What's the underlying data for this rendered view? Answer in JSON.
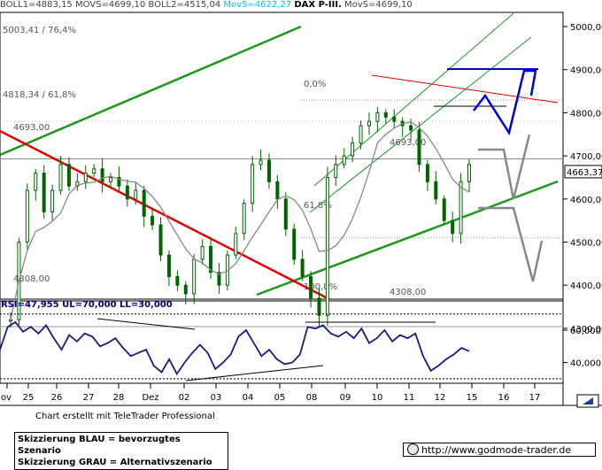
{
  "header": {
    "boll1": "BOLL1=4883,15",
    "movs1": "MOVS=4699,10",
    "boll2": "BOLL2=4515,04",
    "movs2": "MovS=4622,27",
    "title": "DAX P-III.",
    "movs3": "MovS=4699,10",
    "colors": {
      "boll": "#444444",
      "movs_cyan": "#00bfff",
      "title": "#000000"
    }
  },
  "chart_data": [
    {
      "type": "candlestick",
      "name_note": "DAX P-III.",
      "ylim": [
        4280,
        5020
      ],
      "y_ticks": [
        {
          "v": 5000,
          "label": "5000,00"
        },
        {
          "v": 4900,
          "label": "4900,00"
        },
        {
          "v": 4800,
          "label": "4800,00"
        },
        {
          "v": 4700,
          "label": "4700,00"
        },
        {
          "v": 4600,
          "label": "4600,00"
        },
        {
          "v": 4500,
          "label": "4500,00"
        },
        {
          "v": 4400,
          "label": "4400,00"
        },
        {
          "v": 4300,
          "label": "4300,00"
        }
      ],
      "x_ticks": [
        "ov",
        "25",
        "26",
        "27",
        "28",
        "Dez",
        "02",
        "03",
        "04",
        "05",
        "08",
        "09",
        "10",
        "11",
        "12",
        "15",
        "16",
        "17"
      ],
      "last_price": {
        "value": 4663.37,
        "label": "4663,37"
      },
      "close_series": [
        4320,
        4500,
        4620,
        4660,
        4570,
        4620,
        4680,
        4630,
        4640,
        4660,
        4670,
        4640,
        4650,
        4630,
        4600,
        4620,
        4560,
        4540,
        4470,
        4420,
        4400,
        4380,
        4460,
        4490,
        4430,
        4400,
        4470,
        4520,
        4590,
        4680,
        4690,
        4640,
        4600,
        4530,
        4460,
        4420,
        4370,
        4330,
        4650,
        4680,
        4700,
        4730,
        4770,
        4780,
        4800,
        4790,
        4780,
        4770,
        4760,
        4680,
        4640,
        4600,
        4550,
        4520,
        4640,
        4680
      ],
      "fib_levels": [
        {
          "label": "5003,41 / 76,4%",
          "value": 5003.41
        },
        {
          "label": "4818,34 / 61,8%",
          "value": 4818.34
        },
        {
          "label": "4693,00",
          "value": 4693
        },
        {
          "label": "0,0%",
          "value": 4850
        },
        {
          "label": "4693,00",
          "value": 4693
        },
        {
          "label": "61,8%",
          "value": 4520
        },
        {
          "label": "4308,00",
          "value": 4308
        },
        {
          "label": "100,0%",
          "value": 4300
        },
        {
          "label": "4308,00",
          "value": 4308
        }
      ],
      "scenarios": {
        "blue": [
          4740,
          4780,
          4700,
          4840,
          4770,
          4860,
          4800
        ],
        "gray": [
          4660,
          4660,
          4520,
          4500,
          4500,
          4300,
          4410
        ]
      },
      "colors": {
        "candle": "#006400",
        "channel": "#1a9a1a",
        "downtrend": "#e00000",
        "ma": "#888888",
        "blue": "#0000cc",
        "gray": "#888888",
        "fib": "#999999"
      }
    },
    {
      "type": "line",
      "title": "RSI=47,955  UL=70,000  LL=30,000",
      "ylim": [
        25,
        75
      ],
      "y_ticks": [
        {
          "v": 60,
          "label": "60,000"
        },
        {
          "v": 40,
          "label": "40,000"
        }
      ],
      "upper_limit": 70,
      "lower_limit": 30,
      "values": [
        48,
        62,
        65,
        59,
        62,
        58,
        63,
        55,
        48,
        57,
        53,
        58,
        56,
        50,
        52,
        55,
        49,
        44,
        46,
        48,
        38,
        34,
        42,
        33,
        40,
        46,
        51,
        46,
        36,
        40,
        45,
        56,
        60,
        52,
        44,
        48,
        42,
        39,
        40,
        45,
        62,
        61,
        63,
        58,
        56,
        59,
        55,
        61,
        52,
        55,
        60,
        53,
        57,
        55,
        58,
        44,
        35,
        38,
        42,
        45,
        49,
        47
      ]
    }
  ],
  "footer": {
    "credit": "Chart erstellt mit TeleTrader Professional",
    "legend_blue": "Skizzierung BLAU = bevorzugtes Szenario",
    "legend_gray": "Skizzierung GRAU = Alternativszenario",
    "url": "http://www.godmode-trader.de"
  }
}
